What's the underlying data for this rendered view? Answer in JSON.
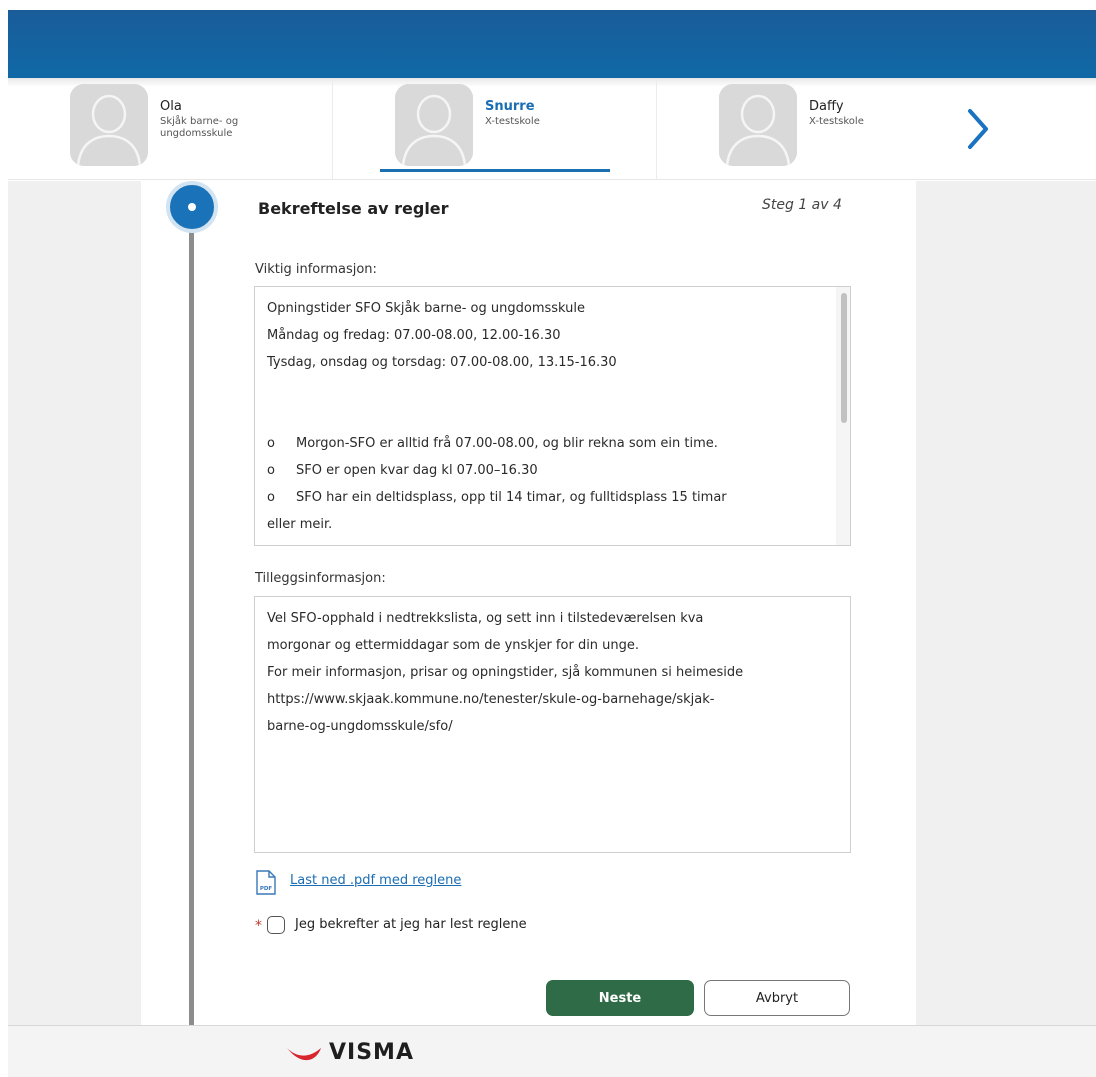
{
  "children": [
    {
      "name": "Ola",
      "school": "Skjåk barne- og ungdomsskule"
    },
    {
      "name": "Snurre",
      "school": "X-testskole"
    },
    {
      "name": "Daffy",
      "school": "X-testskole"
    }
  ],
  "step": {
    "title": "Bekreftelse av regler",
    "indicator": "Steg 1 av 4"
  },
  "important": {
    "label": "Viktig informasjon:",
    "lines": [
      "Opningstider SFO Skjåk barne- og ungdomsskule",
      "Måndag og fredag: 07.00-08.00, 12.00-16.30",
      "Tysdag, onsdag og torsdag: 07.00-08.00, 13.15-16.30"
    ],
    "bullets": [
      "Morgon-SFO er alltid frå 07.00-08.00, og blir rekna som ein time.",
      "SFO er open kvar dag kl 07.00–16.30",
      "SFO har ein deltidsplass, opp til 14 timar, og fulltidsplass 15 timar"
    ],
    "bullet_marker": "o",
    "continuation": "eller meir."
  },
  "additional": {
    "label": "Tilleggsinformasjon:",
    "lines": [
      "Vel SFO-opphald i nedtrekkslista, og sett inn i tilstedeværelsen kva",
      "morgonar og ettermiddagar som de ynskjer for din unge.",
      "For meir informasjon, prisar og opningstider, sjå kommunen si heimeside",
      "https://www.skjaak.kommune.no/tenester/skule-og-barnehage/skjak-",
      "barne-og-ungdomsskule/sfo/"
    ]
  },
  "pdf_link": "Last ned .pdf med reglene",
  "pdf_icon_label": "PDF",
  "confirm": {
    "required_marker": "*",
    "label": "Jeg bekrefter at jeg har lest reglene",
    "checked": false
  },
  "buttons": {
    "next": "Neste",
    "cancel": "Avbryt"
  },
  "footer": {
    "brand": "VISMA"
  },
  "colors": {
    "header_blue": "#0f69a6",
    "accent_blue": "#1a72b8",
    "primary_green": "#2e6b46",
    "brand_red": "#d7262d"
  }
}
